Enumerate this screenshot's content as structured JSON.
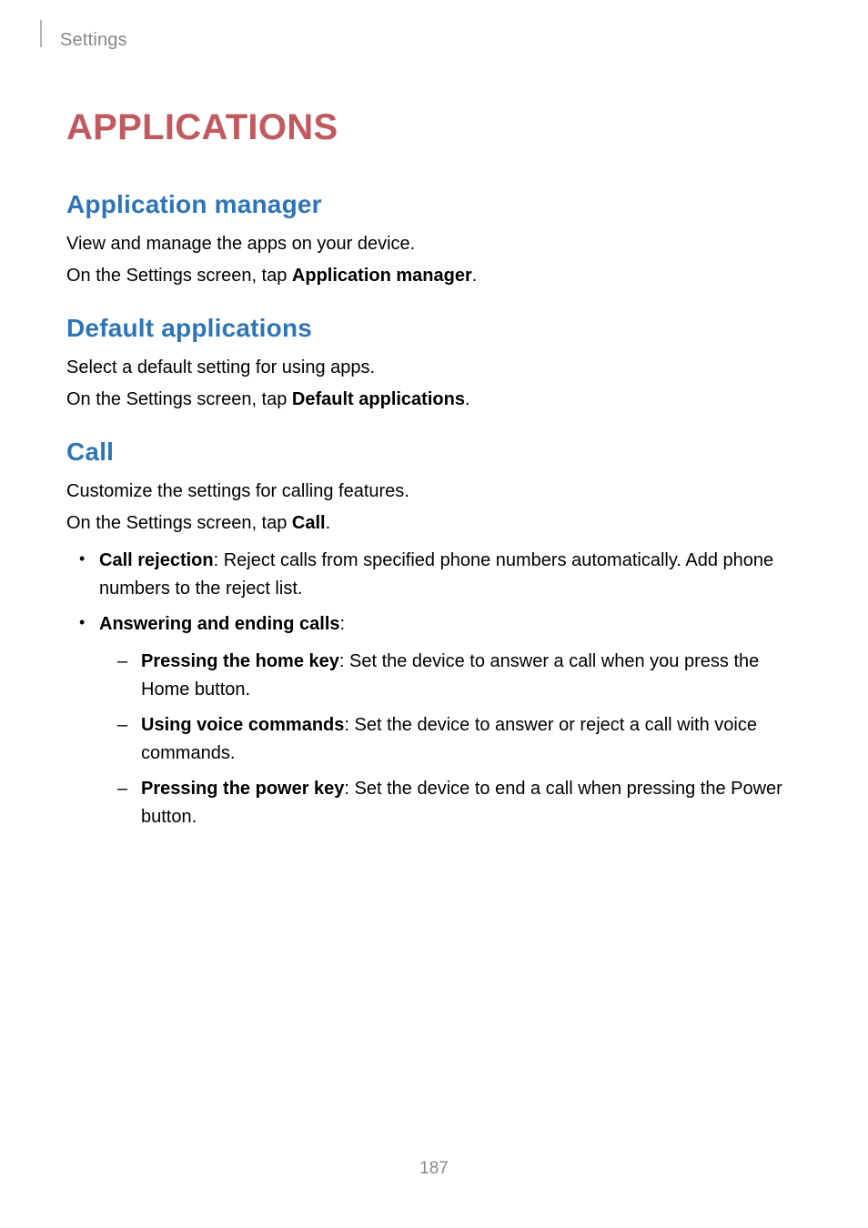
{
  "breadcrumb": "Settings",
  "title": "APPLICATIONS",
  "sections": [
    {
      "heading": "Application manager",
      "p1": "View and manage the apps on your device.",
      "p2_pre": "On the Settings screen, tap ",
      "p2_bold": "Application manager",
      "p2_post": "."
    },
    {
      "heading": "Default applications",
      "p1": "Select a default setting for using apps.",
      "p2_pre": "On the Settings screen, tap ",
      "p2_bold": "Default applications",
      "p2_post": "."
    },
    {
      "heading": "Call",
      "p1": "Customize the settings for calling features.",
      "p2_pre": "On the Settings screen, tap ",
      "p2_bold": "Call",
      "p2_post": "."
    }
  ],
  "call_bullets": {
    "b1_bold": "Call rejection",
    "b1_text": ": Reject calls from specified phone numbers automatically. Add phone numbers to the reject list.",
    "b2_bold": "Answering and ending calls",
    "b2_text": ":",
    "sub": [
      {
        "bold": "Pressing the home key",
        "text": ": Set the device to answer a call when you press the Home button."
      },
      {
        "bold": "Using voice commands",
        "text": ": Set the device to answer or reject a call with voice commands."
      },
      {
        "bold": "Pressing the power key",
        "text": ": Set the device to end a call when pressing the Power button."
      }
    ]
  },
  "page_number": "187"
}
